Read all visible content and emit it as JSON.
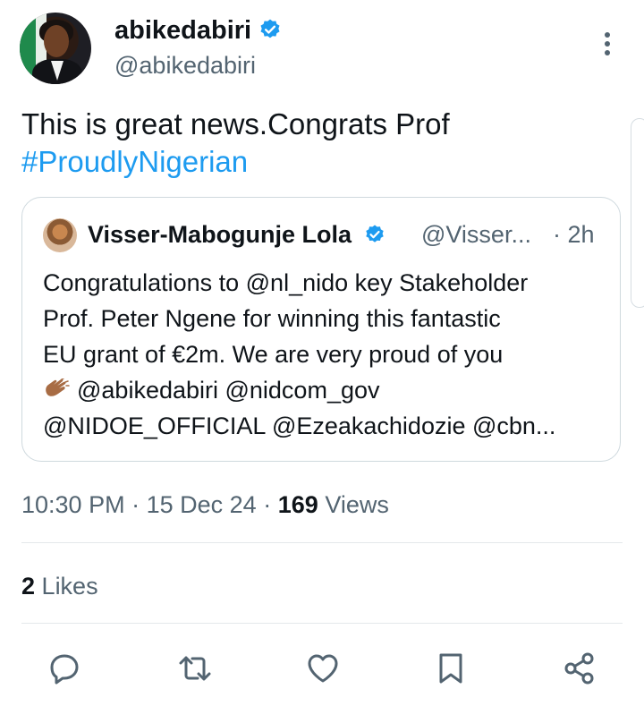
{
  "author": {
    "display_name": "abikedabiri",
    "handle": "@abikedabiri",
    "verified": true
  },
  "tweet": {
    "text": "This is great news.Congrats Prof",
    "hashtag": "#ProudlyNigerian"
  },
  "quoted_tweet": {
    "display_name": "Visser-Mabogunje Lola",
    "handle": "@Visser...",
    "time": "· 2h",
    "lines": [
      "Congratulations to @nl_nido key Stakeholder",
      "Prof. Peter Ngene for winning this fantastic",
      "EU grant of €2m. We are very proud of you",
      "@abikedabiri @nidcom_gov",
      "@NIDOE_OFFICIAL @Ezeakachidozie @cbn..."
    ],
    "emoji": "clapping-hands"
  },
  "meta": {
    "time": "10:30 PM",
    "sep1": "·",
    "date": "15 Dec 24",
    "sep2": "·",
    "views_count": "169",
    "views_label": "Views"
  },
  "likes": {
    "count": "2",
    "label": "Likes"
  },
  "actions": [
    "reply-icon",
    "retweet-icon",
    "like-icon",
    "bookmark-icon",
    "share-icon"
  ],
  "colors": {
    "accent": "#1d9bf0",
    "secondary_text": "#536471",
    "primary_text": "#0f1419"
  }
}
